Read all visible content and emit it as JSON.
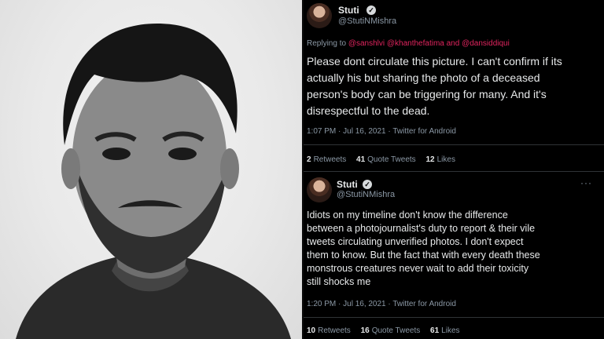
{
  "tweet1": {
    "name": "Stuti",
    "handle": "@StutiNMishra",
    "reply_prefix": "Replying to ",
    "reply_mentions": "@sanshlvi @khanthefatima and @dansiddiqui",
    "text": "Please dont circulate this picture. I can't confirm if its\nactually his but sharing the photo of a deceased\nperson's body can be triggering for many. And it's\ndisrespectful to the dead.",
    "timestamp": "1:07 PM · Jul 16, 2021 · Twitter for Android",
    "retweets_count": "2",
    "retweets_label": "Retweets",
    "quotes_count": "41",
    "quotes_label": "Quote Tweets",
    "likes_count": "12",
    "likes_label": "Likes"
  },
  "tweet2": {
    "name": "Stuti",
    "handle": "@StutiNMishra",
    "more": "···",
    "text": "Idiots on my timeline don't know the difference\nbetween a photojournalist's duty to report & their vile\ntweets circulating unverified photos. I don't expect\nthem to know. But the fact that with every death these\nmonstrous creatures never wait to add their toxicity\nstill shocks me",
    "timestamp": "1:20 PM · Jul 16, 2021 · Twitter for Android",
    "retweets_count": "10",
    "retweets_label": "Retweets",
    "quotes_count": "16",
    "quotes_label": "Quote Tweets",
    "likes_count": "61",
    "likes_label": "Likes"
  },
  "icons": {
    "verified": "verified-badge-icon",
    "more": "more-options-icon"
  }
}
